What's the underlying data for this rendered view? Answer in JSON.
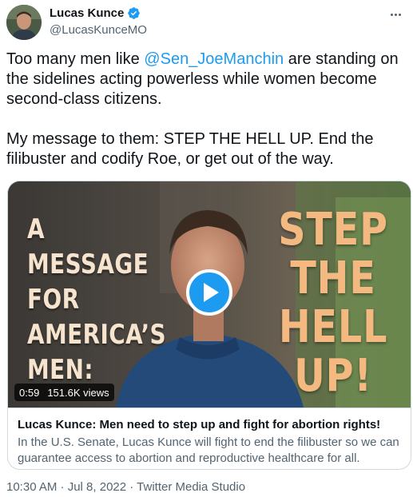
{
  "author": {
    "display_name": "Lucas Kunce",
    "handle": "@LucasKunceMO",
    "verified": true
  },
  "tweet": {
    "mention": "@Sen_JoeManchin",
    "line1_before": "Too many men like ",
    "line1_after": " are standing on the sidelines acting powerless while women become second-class citizens.",
    "paragraph2": "My message to them: STEP THE HELL UP. End the filibuster and codify Roe, or get out of the way."
  },
  "media": {
    "overlay_left": [
      "A",
      "MESSAGE",
      "FOR",
      "AMERICA’S",
      "MEN:"
    ],
    "overlay_right": [
      "STEP",
      "THE",
      "HELL",
      "UP!"
    ],
    "duration": "0:59",
    "views": "151.6K views"
  },
  "card": {
    "title": "Lucas Kunce: Men need to step up and fight for abortion rights!",
    "description": "In the U.S. Senate, Lucas Kunce will fight to end the filibuster so we can guarantee access to abortion and reproductive healthcare for all."
  },
  "timestamp": "10:30 AM · Jul 8, 2022 · Twitter Media Studio",
  "colors": {
    "accent": "#1d9bf0",
    "text_primary": "#0f1419",
    "text_secondary": "#536471",
    "border": "#cfd9de"
  },
  "icons": [
    "verified-badge-icon",
    "more-options-icon",
    "play-icon"
  ]
}
